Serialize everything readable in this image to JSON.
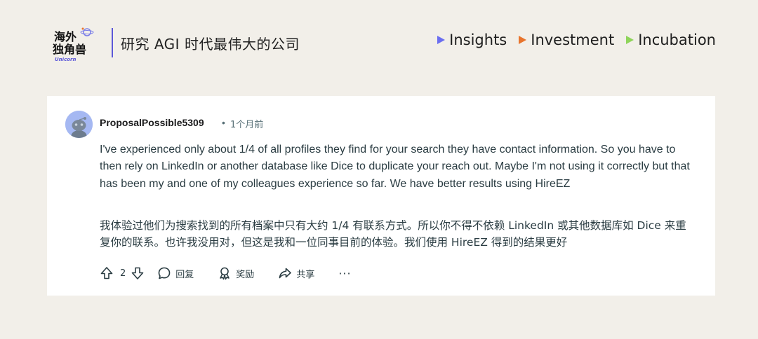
{
  "brand": {
    "logo_text": "海外独角兽",
    "logo_subtext": "Unicorn",
    "tagline": "研究 AGI 时代最伟大的公司",
    "accent": "#5b57d8"
  },
  "nav": [
    {
      "label": "Insights",
      "color": "#6b6ef0"
    },
    {
      "label": "Investment",
      "color": "#e8742d"
    },
    {
      "label": "Incubation",
      "color": "#8fd45a"
    }
  ],
  "comment": {
    "author": "ProposalPossible5309",
    "separator": "•",
    "time": "1个月前",
    "body_en": "I've experienced only about 1/4 of all profiles they find for your search they have contact information. So you have to then rely on LinkedIn or another database like Dice to duplicate your reach out. Maybe I'm not using it correctly but that has been my and one of my colleagues experience so far. We have better results using HireEZ",
    "body_zh": "我体验过他们为搜索找到的所有档案中只有大约 1/4 有联系方式。所以你不得不依赖 LinkedIn 或其他数据库如 Dice 来重复你的联系。也许我没用对，但这是我和一位同事目前的体验。我们使用 HireEZ 得到的结果更好",
    "avatar_icon": "reddit-snoo-avatar-icon"
  },
  "actions": {
    "vote_count": "2",
    "reply_label": "回复",
    "award_label": "奖励",
    "share_label": "共享",
    "more_label": "···"
  }
}
